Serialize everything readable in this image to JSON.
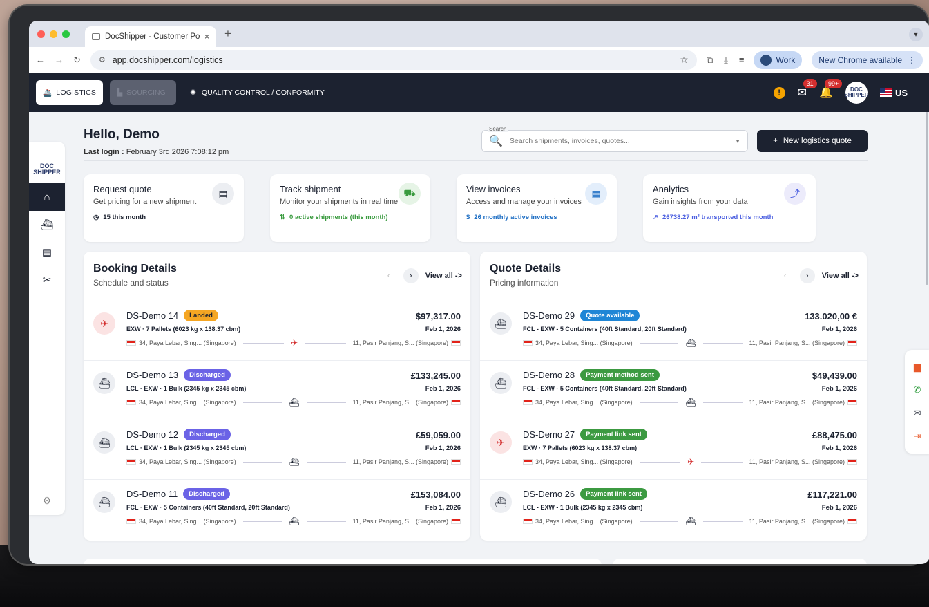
{
  "browser": {
    "tab_title": "DocShipper - Customer Porta",
    "tab_close": "×",
    "new_tab": "+",
    "url": "app.docshipper.com/logistics",
    "work_label": "Work",
    "update_label": "New Chrome available"
  },
  "topnav": {
    "logistics": "LOGISTICS",
    "sourcing": "SOURCING",
    "quality": "QUALITY CONTROL / CONFORMITY",
    "mail_badge": "31",
    "notif_badge": "99+",
    "logo_text": "DOC SHIPPER",
    "lang": "US"
  },
  "sidebar": {
    "logo_text": "DOC SHIPPER"
  },
  "header": {
    "greeting": "Hello, Demo",
    "last_login_label": "Last login :",
    "last_login_value": "February 3rd 2026 7:08:12 pm",
    "search_label": "Search",
    "search_placeholder": "Search shipments, invoices, quotes...",
    "new_quote": "New logistics quote"
  },
  "cards": [
    {
      "title": "Request quote",
      "sub": "Get pricing for a new shipment",
      "metric": "15 this month",
      "color": "#1c2230",
      "icon_bg": "#eceef2"
    },
    {
      "title": "Track shipment",
      "sub": "Monitor your shipments in real time",
      "metric": "0 active shipments (this month)",
      "color": "#3a9b3f",
      "icon_bg": "#e6f4e6"
    },
    {
      "title": "View invoices",
      "sub": "Access and manage your invoices",
      "metric": "26 monthly active invoices",
      "color": "#1f6fc4",
      "icon_bg": "#e3eefb"
    },
    {
      "title": "Analytics",
      "sub": "Gain insights from your data",
      "metric": "26738.27 m³ transported this month",
      "color": "#4a5ee0",
      "icon_bg": "#ecebfb"
    }
  ],
  "booking": {
    "title": "Booking Details",
    "subtitle": "Schedule and status",
    "view_all": "View all ->",
    "rows": [
      {
        "id": "DS-Demo 14",
        "status": "Landed",
        "status_color": "#f5a623",
        "status_text_color": "#1c2230",
        "amount": "$97,317.00",
        "date": "Feb 1, 2026",
        "detail": "EXW · 7 Pallets (6023 kg x 138.37 cbm)",
        "origin": "34, Paya Lebar, Sing... (Singapore)",
        "dest": "11, Pasir Panjang, S... (Singapore)",
        "mode": "plane"
      },
      {
        "id": "DS-Demo 13",
        "status": "Discharged",
        "status_color": "#6b63e6",
        "status_text_color": "#ffffff",
        "amount": "£133,245.00",
        "date": "Feb 1, 2026",
        "detail": "LCL · EXW · 1 Bulk (2345 kg x 2345 cbm)",
        "origin": "34, Paya Lebar, Sing... (Singapore)",
        "dest": "11, Pasir Panjang, S... (Singapore)",
        "mode": "ship"
      },
      {
        "id": "DS-Demo 12",
        "status": "Discharged",
        "status_color": "#6b63e6",
        "status_text_color": "#ffffff",
        "amount": "£59,059.00",
        "date": "Feb 1, 2026",
        "detail": "LCL · EXW · 1 Bulk (2345 kg x 2345 cbm)",
        "origin": "34, Paya Lebar, Sing... (Singapore)",
        "dest": "11, Pasir Panjang, S... (Singapore)",
        "mode": "ship"
      },
      {
        "id": "DS-Demo 11",
        "status": "Discharged",
        "status_color": "#6b63e6",
        "status_text_color": "#ffffff",
        "amount": "£153,084.00",
        "date": "Feb 1, 2026",
        "detail": "FCL · EXW · 5 Containers (40ft Standard, 20ft Standard)",
        "origin": "34, Paya Lebar, Sing... (Singapore)",
        "dest": "11, Pasir Panjang, S... (Singapore)",
        "mode": "ship"
      }
    ]
  },
  "quotes": {
    "title": "Quote Details",
    "subtitle": "Pricing information",
    "view_all": "View all ->",
    "rows": [
      {
        "id": "DS-Demo 29",
        "status": "Quote available",
        "status_color": "#1f86d6",
        "status_text_color": "#ffffff",
        "amount": "133.020,00 €",
        "date": "Feb 1, 2026",
        "detail": "FCL - EXW - 5 Containers (40ft Standard, 20ft Standard)",
        "origin": "34, Paya Lebar, Sing... (Singapore)",
        "dest": "11, Pasir Panjang, S... (Singapore)",
        "mode": "ship"
      },
      {
        "id": "DS-Demo 28",
        "status": "Payment method sent",
        "status_color": "#3c9a41",
        "status_text_color": "#ffffff",
        "amount": "$49,439.00",
        "date": "Feb 1, 2026",
        "detail": "FCL - EXW - 5 Containers (40ft Standard, 20ft Standard)",
        "origin": "34, Paya Lebar, Sing... (Singapore)",
        "dest": "11, Pasir Panjang, S... (Singapore)",
        "mode": "ship"
      },
      {
        "id": "DS-Demo 27",
        "status": "Payment link sent",
        "status_color": "#3c9a41",
        "status_text_color": "#ffffff",
        "amount": "£88,475.00",
        "date": "Feb 1, 2026",
        "detail": "EXW · 7 Pallets (6023 kg x 138.37 cbm)",
        "origin": "34, Paya Lebar, Sing... (Singapore)",
        "dest": "11, Pasir Panjang, S... (Singapore)",
        "mode": "plane"
      },
      {
        "id": "DS-Demo 26",
        "status": "Payment link sent",
        "status_color": "#3c9a41",
        "status_text_color": "#ffffff",
        "amount": "£117,221.00",
        "date": "Feb 1, 2026",
        "detail": "LCL - EXW - 1 Bulk (2345 kg x 2345 cbm)",
        "origin": "34, Paya Lebar, Sing... (Singapore)",
        "dest": "11, Pasir Panjang, S... (Singapore)",
        "mode": "ship"
      }
    ]
  }
}
